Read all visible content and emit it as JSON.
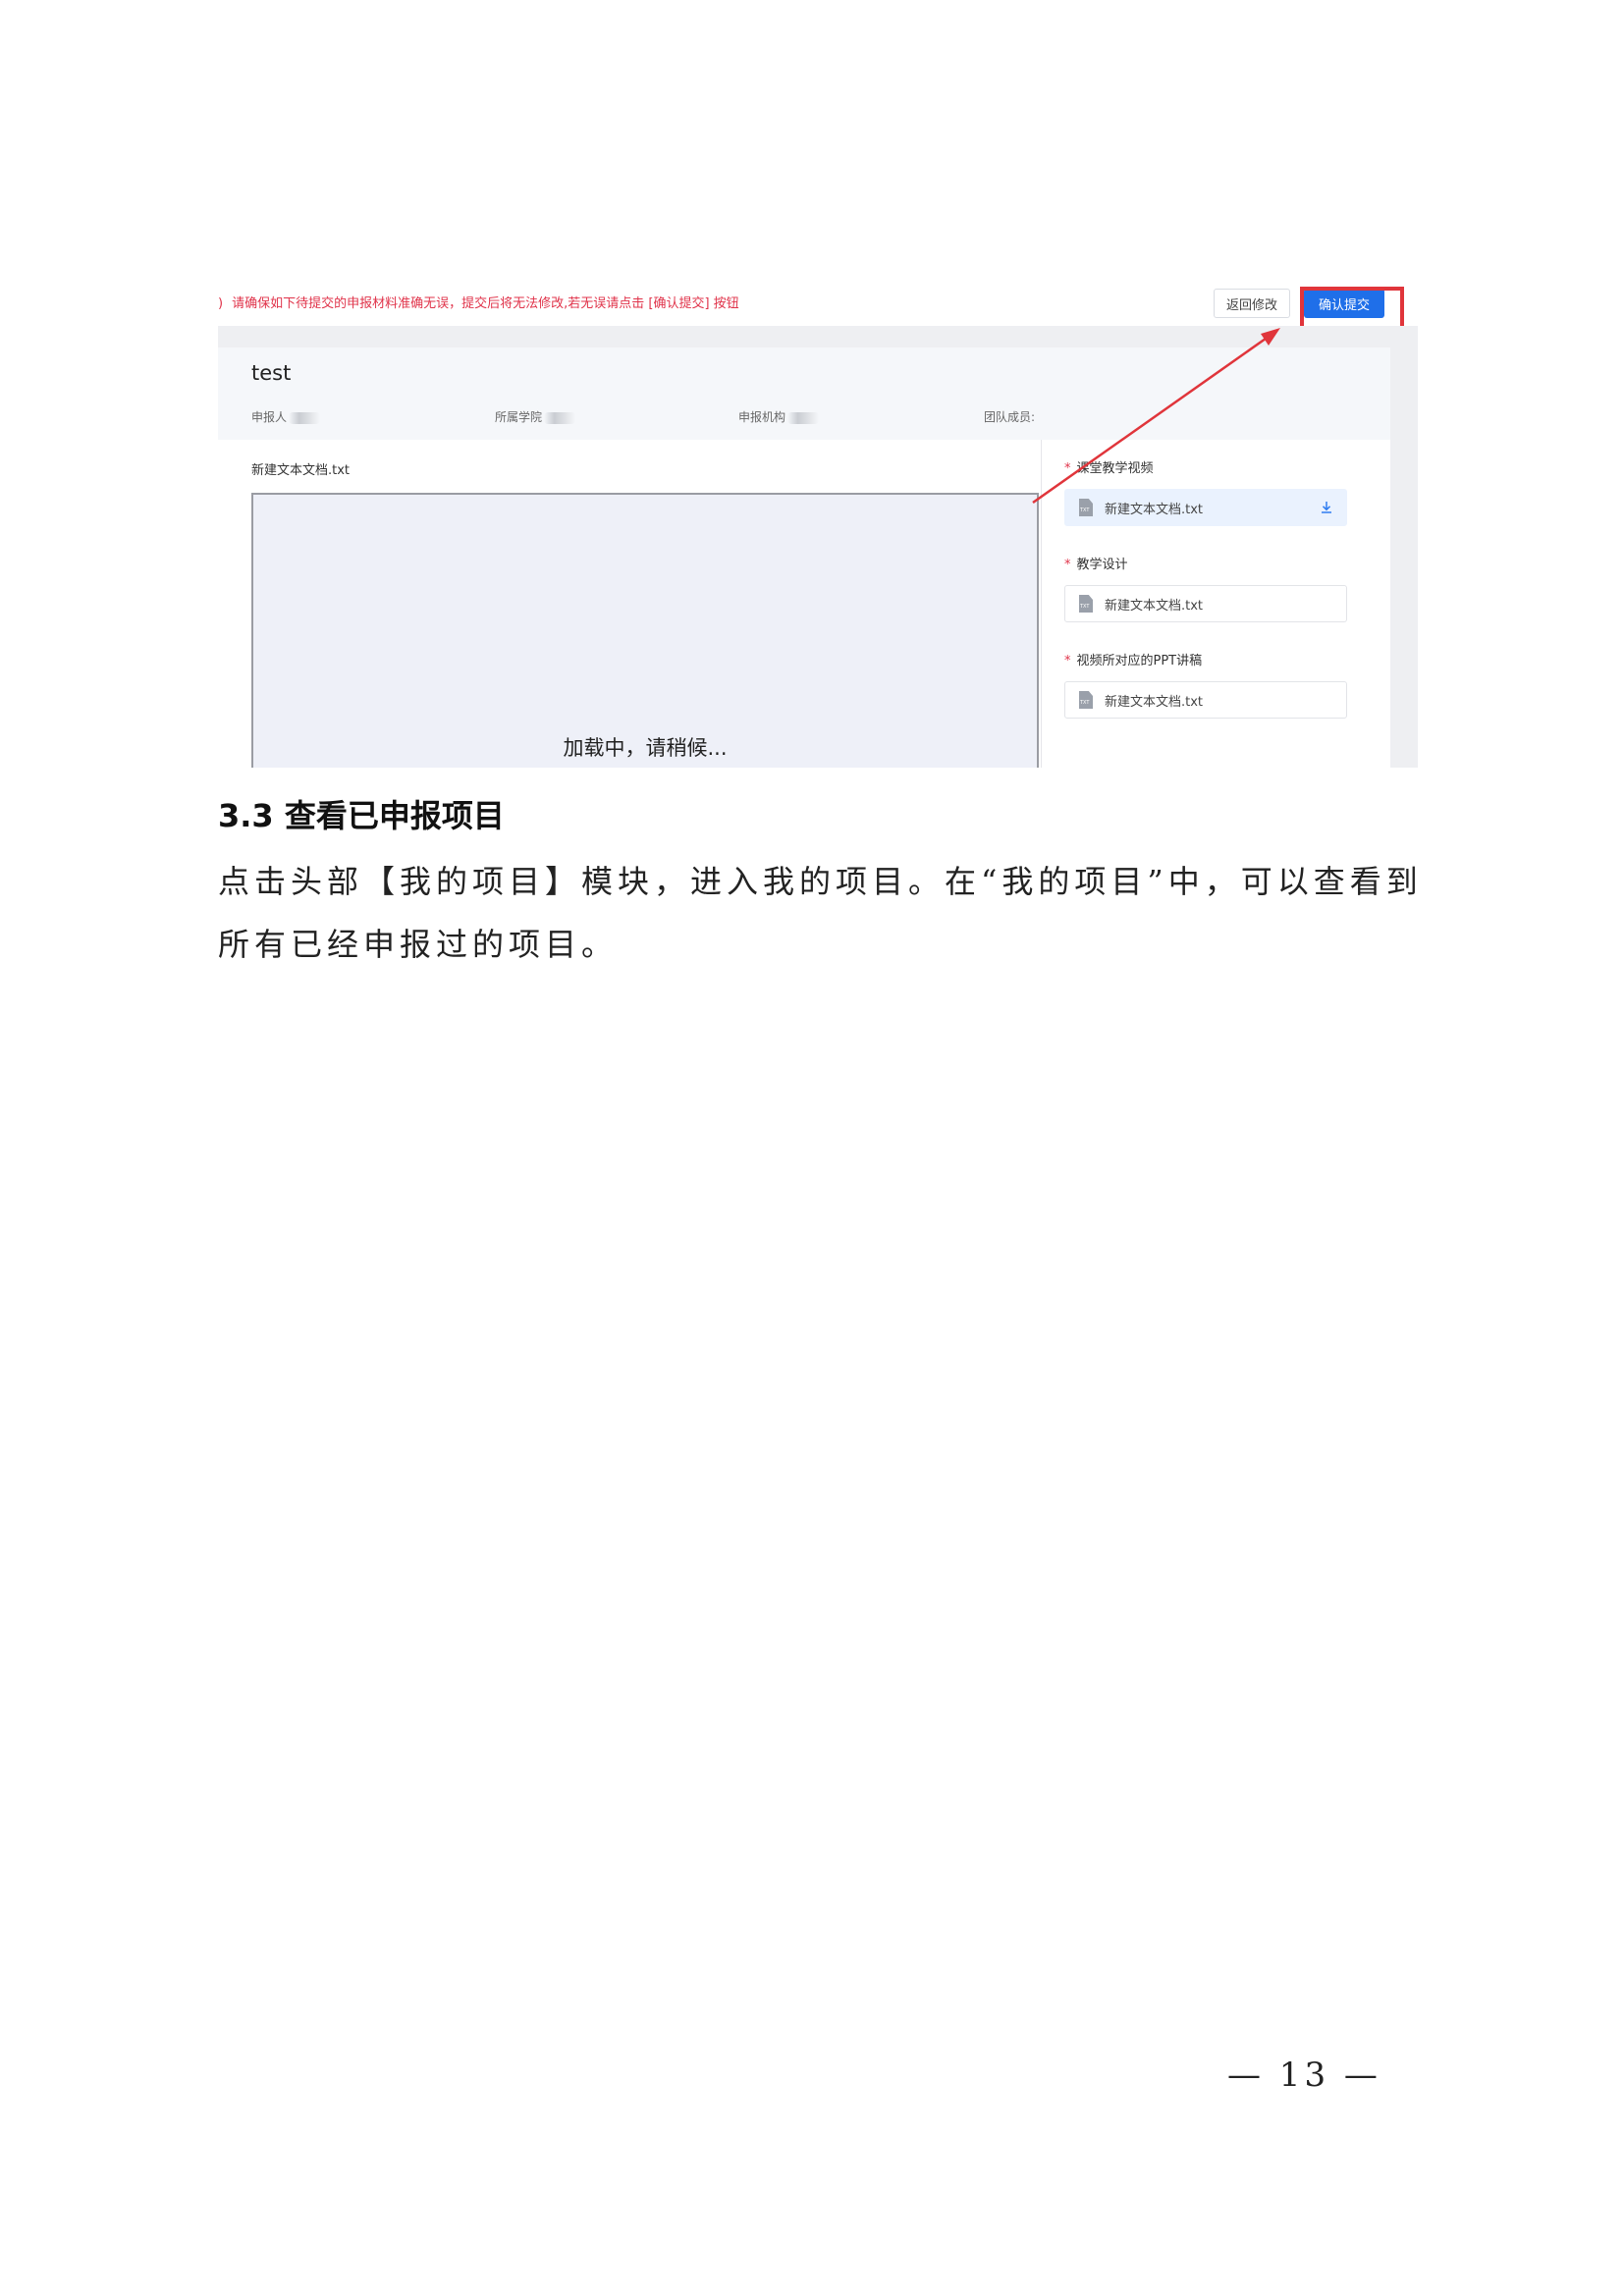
{
  "screenshot": {
    "warning": "请确保如下待提交的申报材料准确无误，提交后将无法修改,若无误请点击 [确认提交] 按钮",
    "back_button": "返回修改",
    "confirm_button": "确认提交",
    "project_title": "test",
    "meta": {
      "applicant": "申报人",
      "college": "所属学院",
      "institution": "申报机构",
      "team": "团队成员:"
    },
    "preview_filename": "新建文本文档.txt",
    "loading_text": "加载中，请稍候...",
    "sections": [
      {
        "label": "课堂教学视频",
        "file": "新建文本文档.txt"
      },
      {
        "label": "教学设计",
        "file": "新建文本文档.txt"
      },
      {
        "label": "视频所对应的PPT讲稿",
        "file": "新建文本文档.txt"
      }
    ],
    "required_mark": "*",
    "file_icon_text": "TXT",
    "highlight_color": "#e0353b",
    "primary_color": "#1f6fe9"
  },
  "doc": {
    "heading": "3.3 查看已申报项目",
    "paragraph": "点击头部【我的项目】模块，进入我的项目。在“我的项目”中，可以查看到所有已经申报过的项目。",
    "page_number": "— 13 —"
  }
}
